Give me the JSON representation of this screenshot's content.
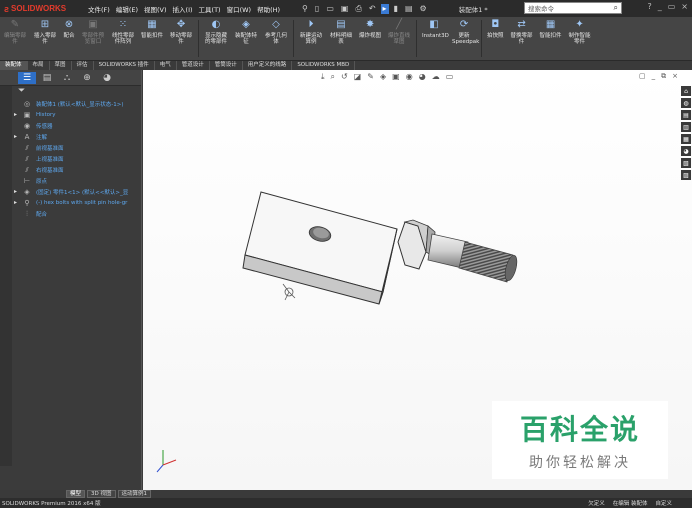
{
  "app": {
    "brand": "SOLIDWORKS",
    "doc_name": "装配体1 *"
  },
  "menus": [
    "文件(F)",
    "编辑(E)",
    "视图(V)",
    "插入(I)",
    "工具(T)",
    "窗口(W)",
    "帮助(H)"
  ],
  "search": {
    "placeholder": "搜索命令"
  },
  "commands": [
    {
      "label": "编辑零部件",
      "icon": "edit-component-icon",
      "dim": true
    },
    {
      "label": "插入零部件",
      "icon": "insert-component-icon",
      "dim": false
    },
    {
      "label": "配合",
      "icon": "mate-icon",
      "dim": false
    },
    {
      "label": "零部件预览窗口",
      "icon": "component-preview-icon",
      "dim": true
    },
    {
      "label": "线性零部件阵列",
      "icon": "linear-pattern-icon",
      "dim": false
    },
    {
      "label": "智能扣件",
      "icon": "smart-fasteners-icon",
      "dim": false
    },
    {
      "label": "移动零部件",
      "icon": "move-component-icon",
      "dim": false
    },
    {
      "label": "显示隐藏的零部件",
      "icon": "show-hidden-icon",
      "dim": false
    },
    {
      "label": "装配体特征",
      "icon": "assembly-features-icon",
      "dim": false
    },
    {
      "label": "参考几何体",
      "icon": "reference-geometry-icon",
      "dim": false
    },
    {
      "label": "新建运动算例",
      "icon": "motion-study-icon",
      "dim": false
    },
    {
      "label": "材料明细表",
      "icon": "bom-icon",
      "dim": false
    },
    {
      "label": "爆炸视图",
      "icon": "exploded-view-icon",
      "dim": false
    },
    {
      "label": "爆炸直线草图",
      "icon": "explode-line-sketch-icon",
      "dim": true
    },
    {
      "label": "Instant3D",
      "icon": "instant3d-icon",
      "dim": false
    },
    {
      "label": "更新Speedpak",
      "icon": "speedpak-icon",
      "dim": false
    },
    {
      "label": "拍快照",
      "icon": "snapshot-icon",
      "dim": false
    },
    {
      "label": "替换零部件",
      "icon": "replace-component-icon",
      "dim": false
    },
    {
      "label": "智能扣件",
      "icon": "smart-fasteners2-icon",
      "dim": false
    },
    {
      "label": "制作智能零件",
      "icon": "make-smart-component-icon",
      "dim": false
    }
  ],
  "tabs": [
    "装配体",
    "布局",
    "草图",
    "评估",
    "SOLIDWORKS 插件",
    "电气",
    "管道设计",
    "管筒设计",
    "用户定义的线路",
    "SOLIDWORKS MBD"
  ],
  "active_tab": "装配体",
  "tree": [
    {
      "label": "装配体1 (默认<默认_显示状态-1>)",
      "icon": "assembly-icon",
      "arrow": "",
      "root": true
    },
    {
      "label": "History",
      "icon": "history-icon",
      "arrow": "▸"
    },
    {
      "label": "传感器",
      "icon": "sensor-icon",
      "arrow": ""
    },
    {
      "label": "注解",
      "icon": "annotation-icon",
      "arrow": "▸"
    },
    {
      "label": "前视基准面",
      "icon": "plane-icon",
      "arrow": ""
    },
    {
      "label": "上视基准面",
      "icon": "plane-icon",
      "arrow": ""
    },
    {
      "label": "右视基准面",
      "icon": "plane-icon",
      "arrow": ""
    },
    {
      "label": "原点",
      "icon": "origin-icon",
      "arrow": ""
    },
    {
      "label": "(固定) 零件1<1> (默认<<默认>_显",
      "icon": "part-icon",
      "arrow": "▸"
    },
    {
      "label": "(-) hex bolts with split pin hole-gr",
      "icon": "bolt-part-icon",
      "arrow": "▸"
    },
    {
      "label": "配合",
      "icon": "mates-icon",
      "arrow": ""
    }
  ],
  "bottom_tabs": [
    "模型",
    "3D 视图",
    "运动算例1"
  ],
  "active_bottom_tab": "模型",
  "status": {
    "left": "SOLIDWORKS Premium 2016 x64 版",
    "right": [
      "欠定义",
      "在编辑 装配体",
      "自定义"
    ]
  },
  "watermark": {
    "big": "百科全说",
    "small": "助你轻松解决"
  }
}
